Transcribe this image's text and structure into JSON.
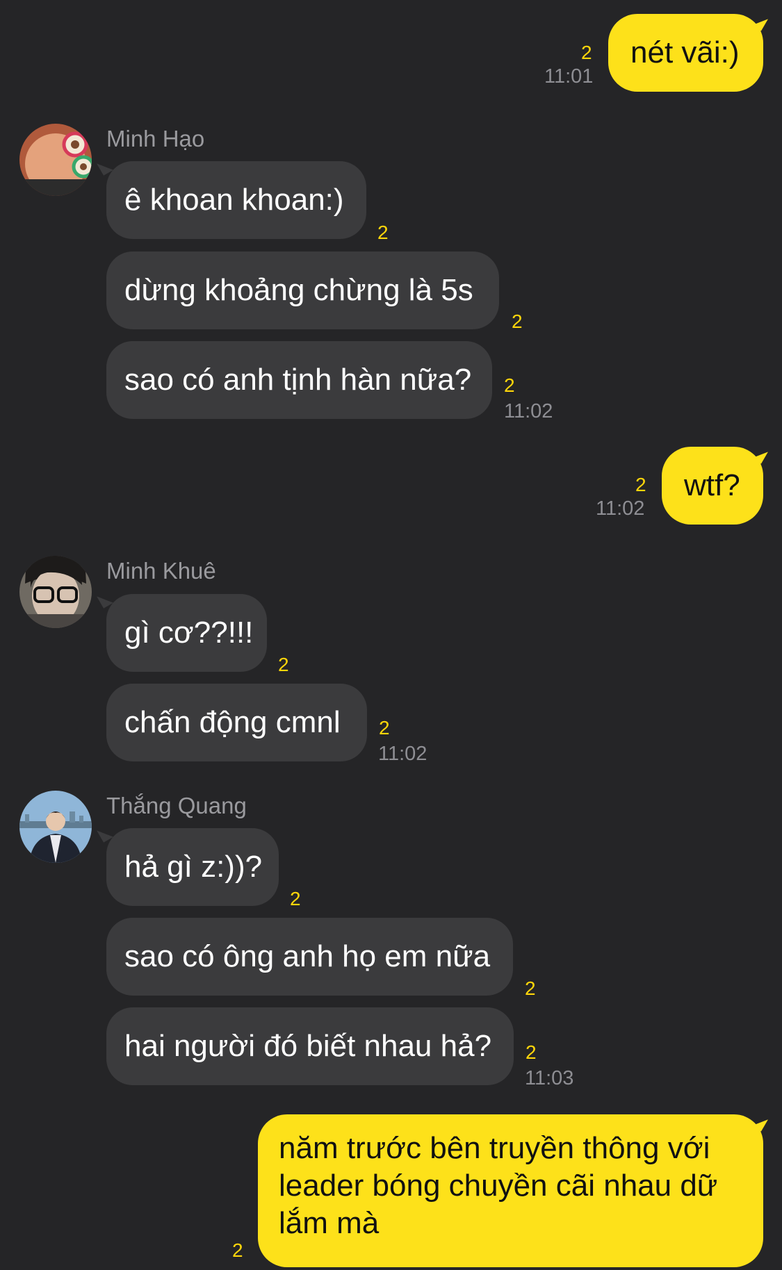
{
  "colors": {
    "background": "#252527",
    "incoming_bubble": "#3b3b3d",
    "outgoing_bubble": "#fde11a",
    "read_count": "#ffd60a",
    "time": "#8e8e93"
  },
  "messages": {
    "m1": {
      "text": "nét vãi:)",
      "count": "2",
      "time": "11:01"
    },
    "g1": {
      "sender": "Minh Hạo",
      "avatar": "avatar-sunglasses-icon",
      "b1": {
        "text": "ê khoan khoan:)",
        "count": "2"
      },
      "b2": {
        "text": "dừng khoảng chừng là 5s",
        "count": "2"
      },
      "b3": {
        "text": "sao có anh tịnh hàn nữa?",
        "count": "2",
        "time": "11:02"
      }
    },
    "m2": {
      "text": "wtf?",
      "count": "2",
      "time": "11:02"
    },
    "g2": {
      "sender": "Minh Khuê",
      "avatar": "avatar-glasses-icon",
      "b1": {
        "text": "gì cơ??!!!",
        "count": "2"
      },
      "b2": {
        "text": "chấn động cmnl",
        "count": "2",
        "time": "11:02"
      }
    },
    "g3": {
      "sender": "Thắng Quang",
      "avatar": "avatar-cityscape-icon",
      "b1": {
        "text": "hả gì z:))?",
        "count": "2"
      },
      "b2": {
        "text": "sao có ông anh họ em nữa",
        "count": "2"
      },
      "b3": {
        "text": "hai người đó biết nhau hả?",
        "count": "2",
        "time": "11:03"
      }
    },
    "m3": {
      "line1": "năm trước bên truyền thông với",
      "line2": "leader bóng chuyền cãi nhau dữ",
      "line3": "lắm mà",
      "count": "2"
    }
  }
}
